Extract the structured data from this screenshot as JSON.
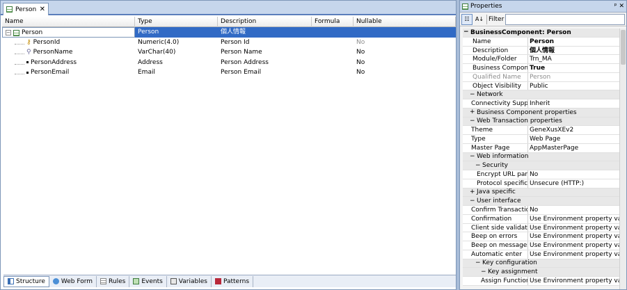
{
  "left": {
    "tab_title": "Person",
    "tab_close": "✕",
    "columns": [
      "Name",
      "Type",
      "Description",
      "Formula",
      "Nullable"
    ],
    "rows": [
      {
        "name": "Person",
        "type": "Person",
        "description": "個人情報",
        "formula": "",
        "nullable": ""
      },
      {
        "name": "PersonId",
        "type": "Numeric(4.0)",
        "description": "Person Id",
        "formula": "",
        "nullable": "No"
      },
      {
        "name": "PersonName",
        "type": "VarChar(40)",
        "description": "Person Name",
        "formula": "",
        "nullable": "No"
      },
      {
        "name": "PersonAddress",
        "type": "Address",
        "description": "Person Address",
        "formula": "",
        "nullable": "No"
      },
      {
        "name": "PersonEmail",
        "type": "Email",
        "description": "Person Email",
        "formula": "",
        "nullable": "No"
      }
    ],
    "bottom_tabs": [
      "Structure",
      "Web Form",
      "Rules",
      "Events",
      "Variables",
      "Patterns"
    ]
  },
  "right": {
    "title": "Properties",
    "pin": "ᵖ",
    "close": "✕",
    "filter_label": "Filter",
    "filter_value": "",
    "rows": [
      {
        "kind": "cat",
        "level": 0,
        "toggle": "−",
        "label": "BusinessComponent: Person"
      },
      {
        "kind": "prop",
        "name": "Name",
        "value": "Person",
        "bold": true
      },
      {
        "kind": "prop",
        "name": "Description",
        "value": "個人情報",
        "bold": true
      },
      {
        "kind": "prop",
        "name": "Module/Folder",
        "value": "Trn_MA"
      },
      {
        "kind": "prop",
        "name": "Business Component",
        "value": "True",
        "bold": true
      },
      {
        "kind": "prop",
        "name": "Qualified Name",
        "value": "Person",
        "dim": true
      },
      {
        "kind": "prop",
        "name": "Object Visibility",
        "value": "Public"
      },
      {
        "kind": "cat",
        "level": 1,
        "toggle": "−",
        "label": "Network"
      },
      {
        "kind": "prop",
        "level": 1,
        "name": "Connectivity Support",
        "value": "Inherit"
      },
      {
        "kind": "cat",
        "level": 1,
        "toggle": "+",
        "label": "Business Component properties"
      },
      {
        "kind": "cat",
        "level": 1,
        "toggle": "−",
        "label": "Web Transaction properties"
      },
      {
        "kind": "prop",
        "level": 1,
        "name": "Theme",
        "value": "GeneXusXEv2"
      },
      {
        "kind": "prop",
        "level": 1,
        "name": "Type",
        "value": "Web Page"
      },
      {
        "kind": "prop",
        "level": 1,
        "name": "Master Page",
        "value": "AppMasterPage"
      },
      {
        "kind": "cat",
        "level": 1,
        "toggle": "−",
        "label": "Web information"
      },
      {
        "kind": "cat",
        "level": 2,
        "toggle": "−",
        "label": "Security"
      },
      {
        "kind": "prop",
        "level": 2,
        "name": "Encrypt URL paran",
        "value": "No"
      },
      {
        "kind": "prop",
        "level": 2,
        "name": "Protocol specificati",
        "value": "Unsecure (HTTP:)"
      },
      {
        "kind": "cat",
        "level": 1,
        "toggle": "+",
        "label": "Java specific"
      },
      {
        "kind": "cat",
        "level": 1,
        "toggle": "−",
        "label": "User interface"
      },
      {
        "kind": "prop",
        "level": 1,
        "name": "Confirm Transactions",
        "value": "No"
      },
      {
        "kind": "prop",
        "level": 1,
        "name": "Confirmation",
        "value": "Use Environment property value"
      },
      {
        "kind": "prop",
        "level": 1,
        "name": "Client side validation",
        "value": "Use Environment property value"
      },
      {
        "kind": "prop",
        "level": 1,
        "name": "Beep on errors",
        "value": "Use Environment property value"
      },
      {
        "kind": "prop",
        "level": 1,
        "name": "Beep on messages",
        "value": "Use Environment property value"
      },
      {
        "kind": "prop",
        "level": 1,
        "name": "Automatic enter",
        "value": "Use Environment property value"
      },
      {
        "kind": "cat",
        "level": 2,
        "toggle": "−",
        "label": "Key configuration"
      },
      {
        "kind": "cat",
        "level": 3,
        "toggle": "−",
        "label": "Key assignment"
      },
      {
        "kind": "prop",
        "level": 3,
        "name": "Assign Function",
        "value": "Use Environment property value"
      }
    ]
  }
}
